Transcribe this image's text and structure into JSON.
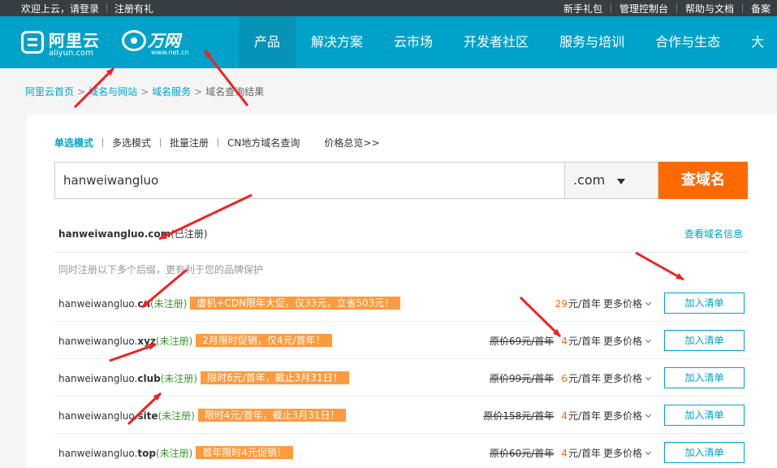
{
  "topbar": {
    "welcome": "欢迎上云，请登录",
    "register": "注册有礼",
    "links": [
      "新手礼包",
      "管理控制台",
      "帮助与文档",
      "备案"
    ]
  },
  "header": {
    "logo_aliyun": {
      "name": "阿里云",
      "url": "aliyun.com"
    },
    "logo_wanwang": {
      "name": "万网",
      "url": "www.net.cn"
    },
    "nav": [
      "产品",
      "解决方案",
      "云市场",
      "开发者社区",
      "服务与培训",
      "合作与生态",
      "大"
    ]
  },
  "breadcrumb": {
    "items": [
      "阿里云首页",
      "域名与网站",
      "域名服务"
    ],
    "current": "域名查询结果",
    "separator": ">"
  },
  "modes": {
    "items": [
      "单选模式",
      "多选模式",
      "批量注册",
      "CN地方域名查询"
    ],
    "price_link": "价格总览>>"
  },
  "search": {
    "value": "hanweiwangluo",
    "suffix": ".com",
    "button": "查域名"
  },
  "main_result": {
    "domain": "hanweiwangluo.com",
    "status": "(已注册)",
    "info_link": "查看域名信息"
  },
  "hint": "同时注册以下多个后缀，更有利于您的品牌保护",
  "rows": [
    {
      "name": "hanweiwangluo.",
      "tld": "cn",
      "status": "(未注册)",
      "promo": "虚机+CDN限年大促，仅33元，立省503元！",
      "orig": "",
      "price": "29",
      "unit": "元/首年",
      "more": "更多价格",
      "add": "加入清单"
    },
    {
      "name": "hanweiwangluo.",
      "tld": "xyz",
      "status": "(未注册)",
      "promo": "2月限时促销，仅4元/首年！",
      "orig": "原价69元/首年",
      "price": "4",
      "unit": "元/首年",
      "more": "更多价格",
      "add": "加入清单"
    },
    {
      "name": "hanweiwangluo.",
      "tld": "club",
      "status": "(未注册)",
      "promo": "限时6元/首年，截止3月31日！",
      "orig": "原价99元/首年",
      "price": "6",
      "unit": "元/首年",
      "more": "更多价格",
      "add": "加入清单"
    },
    {
      "name": "hanweiwangluo.",
      "tld": "site",
      "status": "(未注册)",
      "promo": "限时4元/首年，截止3月31日！",
      "orig": "原价158元/首年",
      "price": "4",
      "unit": "元/首年",
      "more": "更多价格",
      "add": "加入清单"
    },
    {
      "name": "hanweiwangluo.",
      "tld": "top",
      "status": "(未注册)",
      "promo": "首年限时4元促销！",
      "orig": "原价60元/首年",
      "price": "4",
      "unit": "元/首年",
      "more": "更多价格",
      "add": "加入清单"
    }
  ],
  "colors": {
    "brand": "#00a2ca",
    "action": "#ff6a00",
    "promo": "#ff9b3e",
    "annotation_arrow": "#ee2222"
  }
}
